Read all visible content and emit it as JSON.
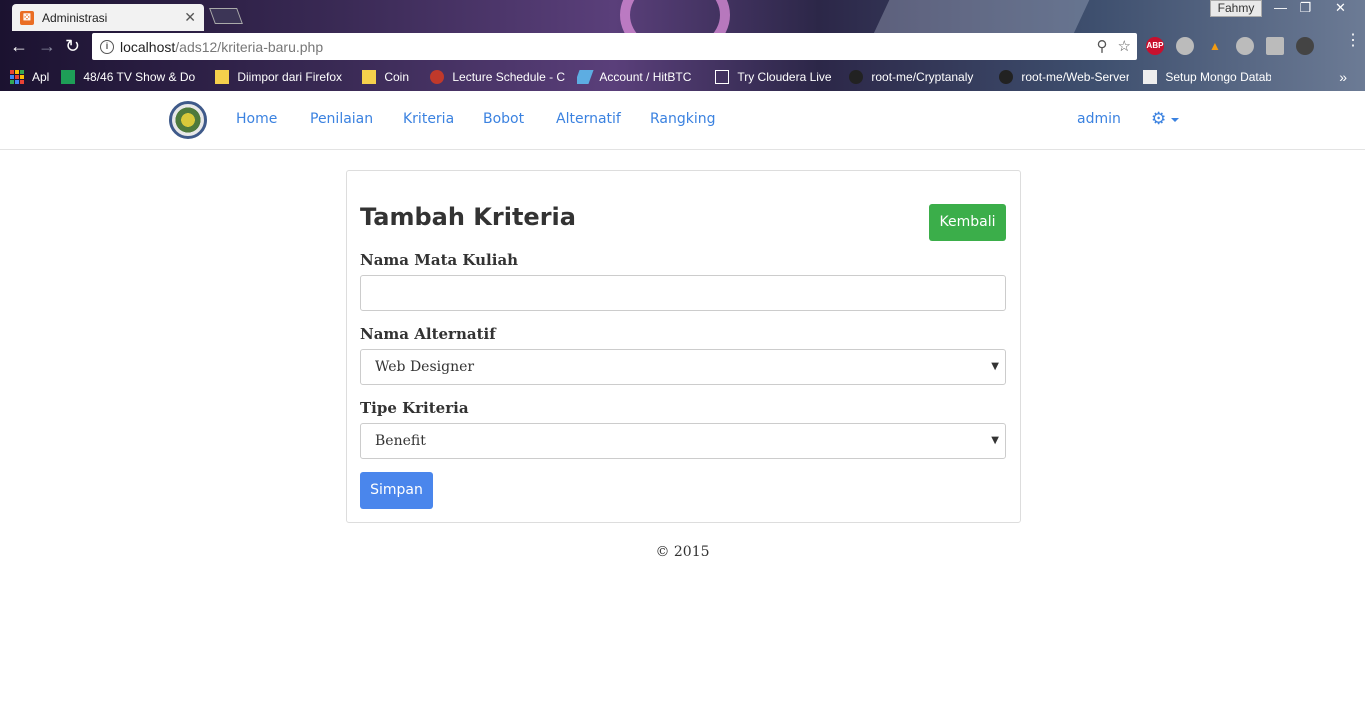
{
  "browser": {
    "tab_title": "Administrasi",
    "profile_name": "Fahmy",
    "url_host": "localhost",
    "url_path": "/ads12/kriteria-baru.php",
    "bookmarks": [
      {
        "label": "Apl",
        "icon": "apps-grid-icon"
      },
      {
        "label": "48/46 TV Show & Do",
        "icon": "sheets-icon"
      },
      {
        "label": "Diimpor dari Firefox",
        "icon": "folder-icon"
      },
      {
        "label": "Coin",
        "icon": "folder-icon"
      },
      {
        "label": "Lecture Schedule - C",
        "icon": "apple-icon"
      },
      {
        "label": "Account / HitBTC",
        "icon": "bird-icon"
      },
      {
        "label": "Try Cloudera Live",
        "icon": "page-icon"
      },
      {
        "label": "root-me/Cryptanaly",
        "icon": "github-icon"
      },
      {
        "label": "root-me/Web-Server",
        "icon": "github-icon"
      },
      {
        "label": "Setup Mongo Datab",
        "icon": "page-icon"
      }
    ]
  },
  "navbar": {
    "links": [
      "Home",
      "Penilaian",
      "Kriteria",
      "Bobot",
      "Alternatif",
      "Rangking"
    ],
    "user": "admin"
  },
  "form": {
    "title": "Tambah Kriteria",
    "back_label": "Kembali",
    "field1_label": "Nama Mata Kuliah",
    "field1_value": "",
    "field2_label": "Nama Alternatif",
    "field2_value": "Web Designer",
    "field3_label": "Tipe Kriteria",
    "field3_value": "Benefit",
    "submit_label": "Simpan"
  },
  "footer": {
    "text": "© 2015"
  },
  "colors": {
    "link": "#3b82e0",
    "success": "#3bae4a",
    "primary": "#4a86ec"
  }
}
